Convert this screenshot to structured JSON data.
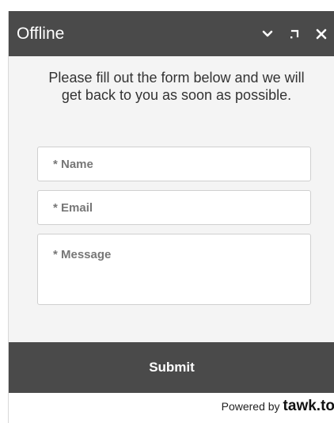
{
  "header": {
    "title": "Offline",
    "icons": [
      "chevron-down-icon",
      "popout-icon",
      "close-icon"
    ]
  },
  "intro": {
    "text": "Please fill out the form below and we will get back to you as soon as possible."
  },
  "form": {
    "name_placeholder": "* Name",
    "email_placeholder": "* Email",
    "message_placeholder": "* Message",
    "submit_label": "Submit"
  },
  "footer": {
    "powered_by": "Powered by",
    "brand": "tawk.to"
  },
  "colors": {
    "header_bg": "#4a4a4a",
    "body_bg": "#f4f4f4",
    "submit_bg": "#4a4a4a",
    "text": "#333333"
  }
}
